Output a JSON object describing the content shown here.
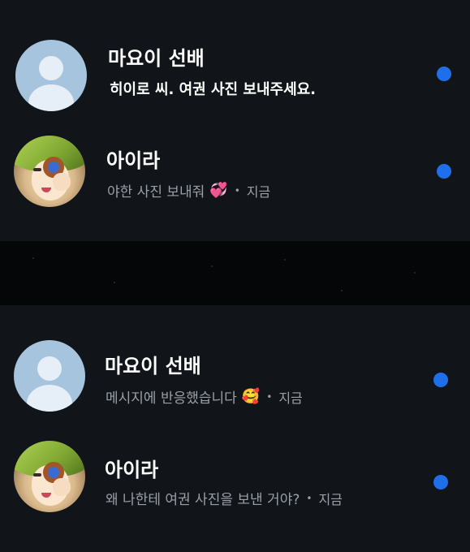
{
  "chats_top": [
    {
      "name": "마요이 선배",
      "message": "히이로 씨. 여권 사진 보내주세요.",
      "time": "",
      "avatar": "default-avatar",
      "unread": true
    },
    {
      "name": "아이라",
      "message": "야한 사진 보내줘",
      "emoji": "💞",
      "time": "지금",
      "avatar": "anime-avatar",
      "unread": true
    }
  ],
  "chats_bottom": [
    {
      "name": "마요이 선배",
      "message": "메시지에 반응했습니다",
      "emoji": "🥰",
      "time": "지금",
      "avatar": "default-avatar",
      "unread": true
    },
    {
      "name": "아이라",
      "message": "왜 나한테 여권 사진을 보낸 거야?",
      "time": "지금",
      "avatar": "anime-avatar",
      "unread": true
    }
  ],
  "separator": "•",
  "colors": {
    "background": "#111418",
    "unread_dot": "#1f6feb",
    "muted_text": "#9aa0a8"
  }
}
